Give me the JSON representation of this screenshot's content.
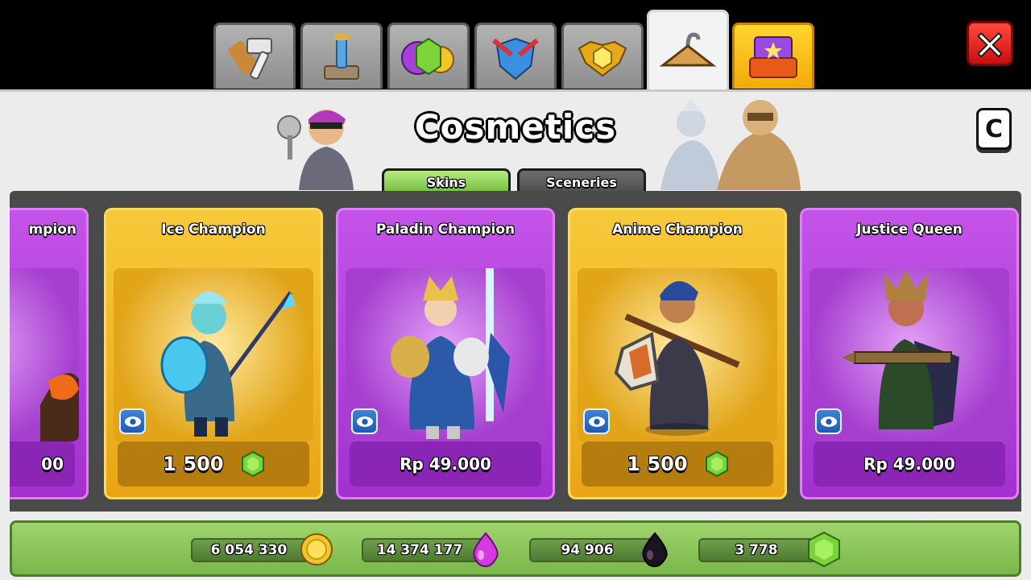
{
  "window": {
    "title": "Cosmetics",
    "close_label": "X",
    "corner_badge": "C"
  },
  "top_tabs": [
    {
      "icon": "hammer-tools-icon",
      "active": false
    },
    {
      "icon": "potion-tower-icon",
      "active": false
    },
    {
      "icon": "gems-coins-icon",
      "active": false
    },
    {
      "icon": "shield-swords-icon",
      "active": false
    },
    {
      "icon": "gold-badge-icon",
      "active": false
    },
    {
      "icon": "hanger-icon",
      "active": true
    },
    {
      "icon": "shop-cards-icon",
      "active": false
    }
  ],
  "sub_tabs": {
    "skins": "Skins",
    "sceneries": "Sceneries",
    "active": "Skins"
  },
  "cards": [
    {
      "title": "mpion",
      "price": "00",
      "theme": "purple"
    },
    {
      "title": "Ice Champion",
      "price": "1 500",
      "currency": "gem",
      "theme": "gold"
    },
    {
      "title": "Paladin Champion",
      "price": "Rp 49.000",
      "theme": "purple"
    },
    {
      "title": "Anime Champion",
      "price": "1 500",
      "currency": "gem",
      "theme": "gold"
    },
    {
      "title": "Justice Queen",
      "price": "Rp 49.000",
      "theme": "purple"
    }
  ],
  "resources": {
    "gold": "6 054 330",
    "elixir": "14 374 177",
    "dark_elixir": "94 906",
    "gems": "3 778"
  },
  "colors": {
    "purple_card": "#b13fdc",
    "gold_card": "#f0b62a",
    "resource_bar": "#8cc75a",
    "close_button": "#e0241a"
  }
}
